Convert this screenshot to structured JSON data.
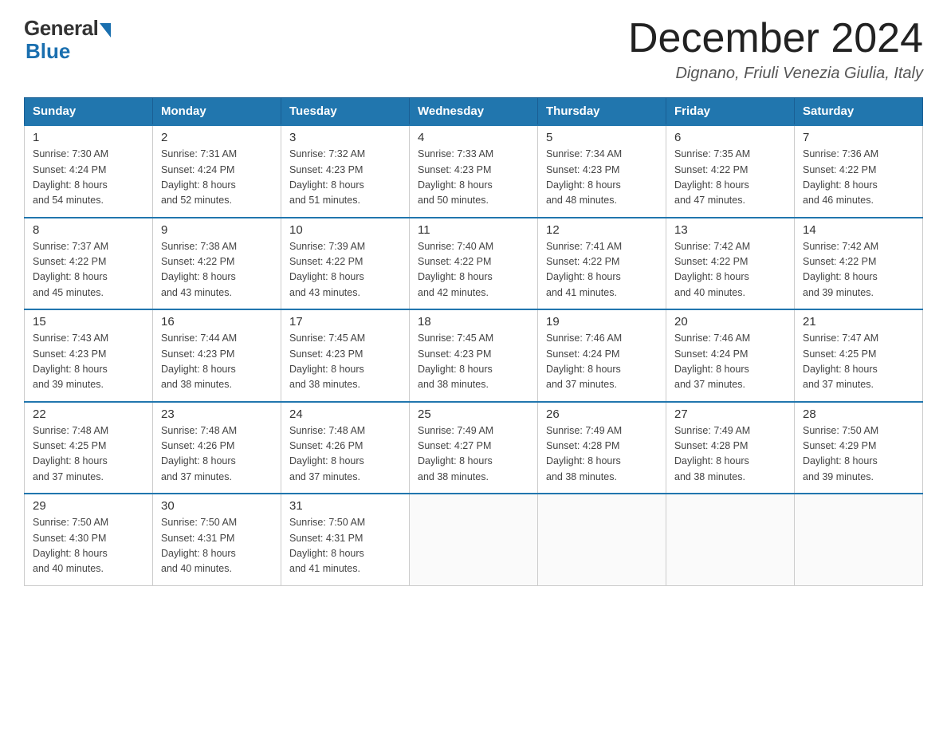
{
  "header": {
    "logo_general": "General",
    "logo_blue": "Blue",
    "title": "December 2024",
    "subtitle": "Dignano, Friuli Venezia Giulia, Italy"
  },
  "weekdays": [
    "Sunday",
    "Monday",
    "Tuesday",
    "Wednesday",
    "Thursday",
    "Friday",
    "Saturday"
  ],
  "weeks": [
    [
      {
        "day": "1",
        "sunrise": "7:30 AM",
        "sunset": "4:24 PM",
        "daylight": "8 hours and 54 minutes."
      },
      {
        "day": "2",
        "sunrise": "7:31 AM",
        "sunset": "4:24 PM",
        "daylight": "8 hours and 52 minutes."
      },
      {
        "day": "3",
        "sunrise": "7:32 AM",
        "sunset": "4:23 PM",
        "daylight": "8 hours and 51 minutes."
      },
      {
        "day": "4",
        "sunrise": "7:33 AM",
        "sunset": "4:23 PM",
        "daylight": "8 hours and 50 minutes."
      },
      {
        "day": "5",
        "sunrise": "7:34 AM",
        "sunset": "4:23 PM",
        "daylight": "8 hours and 48 minutes."
      },
      {
        "day": "6",
        "sunrise": "7:35 AM",
        "sunset": "4:22 PM",
        "daylight": "8 hours and 47 minutes."
      },
      {
        "day": "7",
        "sunrise": "7:36 AM",
        "sunset": "4:22 PM",
        "daylight": "8 hours and 46 minutes."
      }
    ],
    [
      {
        "day": "8",
        "sunrise": "7:37 AM",
        "sunset": "4:22 PM",
        "daylight": "8 hours and 45 minutes."
      },
      {
        "day": "9",
        "sunrise": "7:38 AM",
        "sunset": "4:22 PM",
        "daylight": "8 hours and 43 minutes."
      },
      {
        "day": "10",
        "sunrise": "7:39 AM",
        "sunset": "4:22 PM",
        "daylight": "8 hours and 43 minutes."
      },
      {
        "day": "11",
        "sunrise": "7:40 AM",
        "sunset": "4:22 PM",
        "daylight": "8 hours and 42 minutes."
      },
      {
        "day": "12",
        "sunrise": "7:41 AM",
        "sunset": "4:22 PM",
        "daylight": "8 hours and 41 minutes."
      },
      {
        "day": "13",
        "sunrise": "7:42 AM",
        "sunset": "4:22 PM",
        "daylight": "8 hours and 40 minutes."
      },
      {
        "day": "14",
        "sunrise": "7:42 AM",
        "sunset": "4:22 PM",
        "daylight": "8 hours and 39 minutes."
      }
    ],
    [
      {
        "day": "15",
        "sunrise": "7:43 AM",
        "sunset": "4:23 PM",
        "daylight": "8 hours and 39 minutes."
      },
      {
        "day": "16",
        "sunrise": "7:44 AM",
        "sunset": "4:23 PM",
        "daylight": "8 hours and 38 minutes."
      },
      {
        "day": "17",
        "sunrise": "7:45 AM",
        "sunset": "4:23 PM",
        "daylight": "8 hours and 38 minutes."
      },
      {
        "day": "18",
        "sunrise": "7:45 AM",
        "sunset": "4:23 PM",
        "daylight": "8 hours and 38 minutes."
      },
      {
        "day": "19",
        "sunrise": "7:46 AM",
        "sunset": "4:24 PM",
        "daylight": "8 hours and 37 minutes."
      },
      {
        "day": "20",
        "sunrise": "7:46 AM",
        "sunset": "4:24 PM",
        "daylight": "8 hours and 37 minutes."
      },
      {
        "day": "21",
        "sunrise": "7:47 AM",
        "sunset": "4:25 PM",
        "daylight": "8 hours and 37 minutes."
      }
    ],
    [
      {
        "day": "22",
        "sunrise": "7:48 AM",
        "sunset": "4:25 PM",
        "daylight": "8 hours and 37 minutes."
      },
      {
        "day": "23",
        "sunrise": "7:48 AM",
        "sunset": "4:26 PM",
        "daylight": "8 hours and 37 minutes."
      },
      {
        "day": "24",
        "sunrise": "7:48 AM",
        "sunset": "4:26 PM",
        "daylight": "8 hours and 37 minutes."
      },
      {
        "day": "25",
        "sunrise": "7:49 AM",
        "sunset": "4:27 PM",
        "daylight": "8 hours and 38 minutes."
      },
      {
        "day": "26",
        "sunrise": "7:49 AM",
        "sunset": "4:28 PM",
        "daylight": "8 hours and 38 minutes."
      },
      {
        "day": "27",
        "sunrise": "7:49 AM",
        "sunset": "4:28 PM",
        "daylight": "8 hours and 38 minutes."
      },
      {
        "day": "28",
        "sunrise": "7:50 AM",
        "sunset": "4:29 PM",
        "daylight": "8 hours and 39 minutes."
      }
    ],
    [
      {
        "day": "29",
        "sunrise": "7:50 AM",
        "sunset": "4:30 PM",
        "daylight": "8 hours and 40 minutes."
      },
      {
        "day": "30",
        "sunrise": "7:50 AM",
        "sunset": "4:31 PM",
        "daylight": "8 hours and 40 minutes."
      },
      {
        "day": "31",
        "sunrise": "7:50 AM",
        "sunset": "4:31 PM",
        "daylight": "8 hours and 41 minutes."
      },
      null,
      null,
      null,
      null
    ]
  ],
  "labels": {
    "sunrise": "Sunrise:",
    "sunset": "Sunset:",
    "daylight": "Daylight:"
  }
}
